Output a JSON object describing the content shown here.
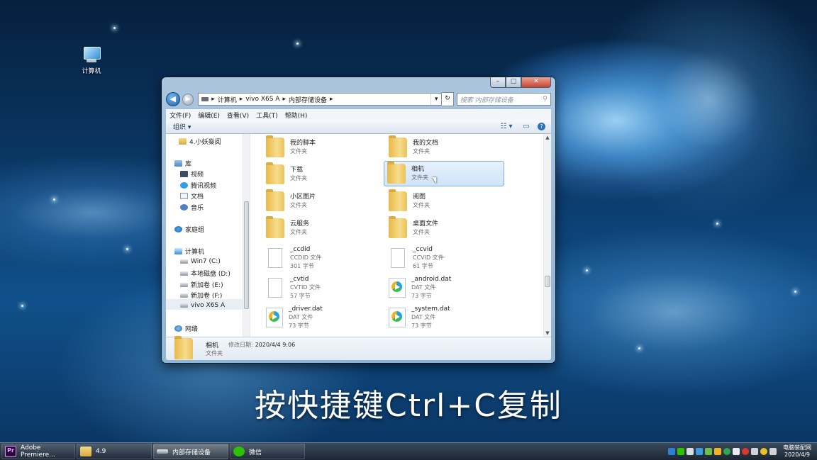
{
  "desktop": {
    "icon_label": "计算机",
    "subtitle": "按快捷键Ctrl+C复制"
  },
  "window": {
    "caption_buttons": {
      "minimize": "–",
      "maximize": "□",
      "close": "✕"
    },
    "address": {
      "crumbs": [
        "计算机",
        "vivo X6S A",
        "内部存储设备"
      ],
      "separator": "▸",
      "dropdown": "▾",
      "refresh": "↻"
    },
    "search_placeholder": "搜索 内部存储设备",
    "menu": [
      "文件(F)",
      "编辑(E)",
      "查看(V)",
      "工具(T)",
      "帮助(H)"
    ],
    "toolbar": {
      "organize": "组织 ▾",
      "view_icon": "☷ ▾",
      "pane_icon": "▭",
      "help_icon": "?"
    },
    "nav": [
      {
        "label": "4.小妖燊阅",
        "icon": "folder-icon"
      },
      {
        "label": "库",
        "icon": "library-icon"
      },
      {
        "label": "视频",
        "icon": "video-icon"
      },
      {
        "label": "腾讯视频",
        "icon": "tencent-video-icon"
      },
      {
        "label": "文档",
        "icon": "document-icon"
      },
      {
        "label": "音乐",
        "icon": "music-icon"
      },
      {
        "label": "家庭组",
        "icon": "homegroup-icon"
      },
      {
        "label": "计算机",
        "icon": "computer-icon"
      },
      {
        "label": "Win7 (C:)",
        "icon": "drive-icon"
      },
      {
        "label": "本地磁盘 (D:)",
        "icon": "drive-icon"
      },
      {
        "label": "新加卷 (E:)",
        "icon": "drive-icon"
      },
      {
        "label": "新加卷 (F:)",
        "icon": "drive-icon"
      },
      {
        "label": "vivo X6S A",
        "icon": "phone-icon"
      },
      {
        "label": "网络",
        "icon": "network-icon"
      }
    ],
    "items": [
      {
        "name": "我的脚本",
        "type": "文件夹",
        "size": "",
        "icon": "folder-icon"
      },
      {
        "name": "我的文档",
        "type": "文件夹",
        "size": "",
        "icon": "folder-icon"
      },
      {
        "name": "下载",
        "type": "文件夹",
        "size": "",
        "icon": "folder-icon"
      },
      {
        "name": "相机",
        "type": "文件夹",
        "size": "",
        "icon": "folder-icon"
      },
      {
        "name": "小区图片",
        "type": "文件夹",
        "size": "",
        "icon": "folder-icon"
      },
      {
        "name": "阅图",
        "type": "文件夹",
        "size": "",
        "icon": "folder-icon"
      },
      {
        "name": "云服务",
        "type": "文件夹",
        "size": "",
        "icon": "folder-icon"
      },
      {
        "name": "桌面文件",
        "type": "文件夹",
        "size": "",
        "icon": "folder-icon"
      },
      {
        "name": "_ccdid",
        "type": "CCDID 文件",
        "size": "301 字节",
        "icon": "file-icon"
      },
      {
        "name": "_ccvid",
        "type": "CCVID 文件",
        "size": "61 字节",
        "icon": "file-icon"
      },
      {
        "name": "_cvtid",
        "type": "CVTID 文件",
        "size": "57 字节",
        "icon": "file-icon"
      },
      {
        "name": "_android.dat",
        "type": "DAT 文件",
        "size": "73 字节",
        "icon": "vcd-file-icon"
      },
      {
        "name": "_driver.dat",
        "type": "DAT 文件",
        "size": "73 字节",
        "icon": "vcd-file-icon"
      },
      {
        "name": "_system.dat",
        "type": "DAT 文件",
        "size": "73 字节",
        "icon": "vcd-file-icon"
      }
    ],
    "selected_item": "相机",
    "details": {
      "name": "相机",
      "modified_label": "修改日期:",
      "modified_value": "2020/4/4 9:06",
      "type": "文件夹"
    }
  },
  "taskbar": {
    "tasks": [
      "Adobe Premiere...",
      "4.9",
      "内部存储设备",
      "微信"
    ],
    "clock_time": "电脑装配网",
    "clock_date": "2020/4/9"
  }
}
